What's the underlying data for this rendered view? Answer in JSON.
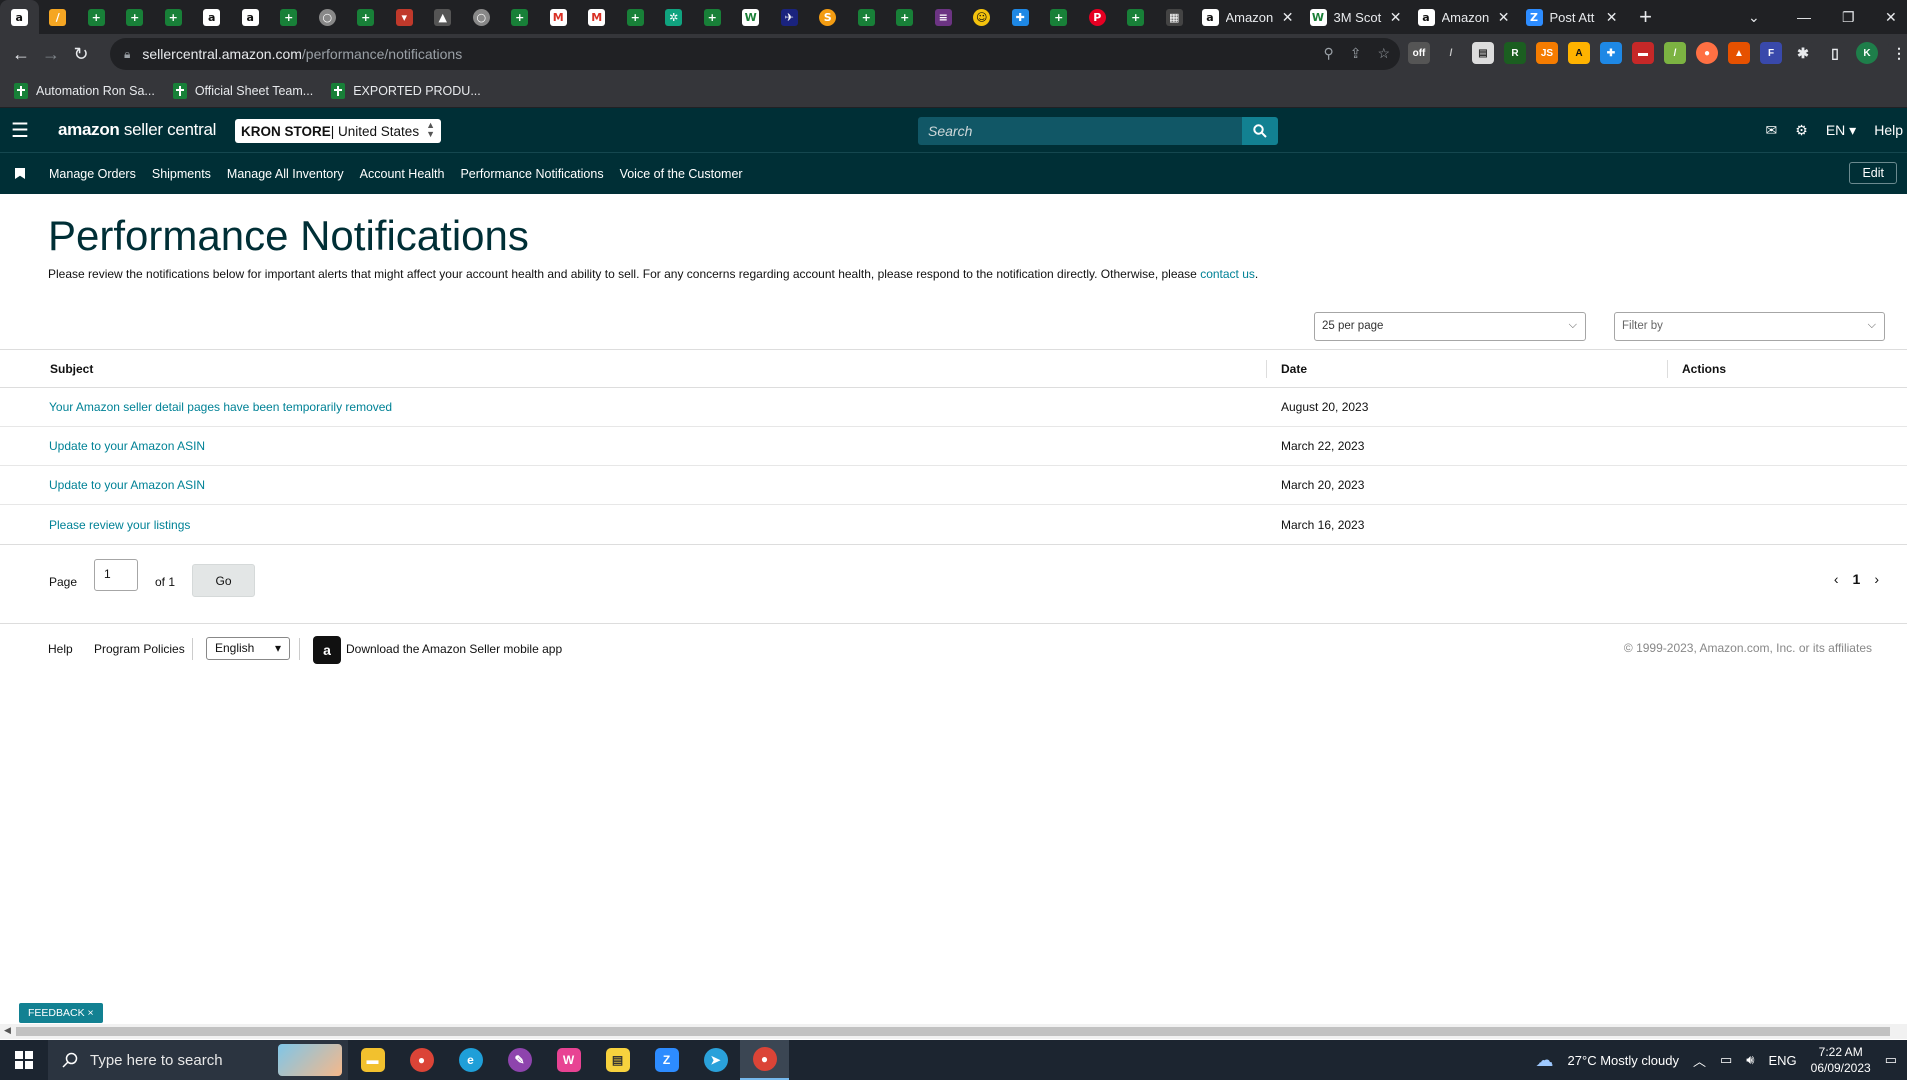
{
  "browser": {
    "tabs_full": [
      {
        "title": "Amazon",
        "icon": "amazon-icon"
      },
      {
        "title": "3M Scot",
        "icon": "w-icon"
      },
      {
        "title": "Amazon",
        "icon": "amazon-icon"
      },
      {
        "title": "Post Att",
        "icon": "z-icon"
      }
    ],
    "new_tab": "+",
    "url_host": "sellercentral.amazon.com",
    "url_path": "/performance/notifications",
    "bookmarks": [
      {
        "label": "Automation Ron Sa..."
      },
      {
        "label": "Official Sheet Team..."
      },
      {
        "label": "EXPORTED PRODU..."
      }
    ],
    "profile_initial": "K"
  },
  "header": {
    "logo_bold": "amazon",
    "logo_light": " seller central",
    "store_name": "KRON STORE",
    "store_market": " | United States",
    "search_placeholder": "Search",
    "language": "EN",
    "help": "Help"
  },
  "nav": {
    "links": [
      "Manage Orders",
      "Shipments",
      "Manage All Inventory",
      "Account Health",
      "Performance Notifications",
      "Voice of the Customer"
    ],
    "edit": "Edit"
  },
  "page": {
    "title": "Performance Notifications",
    "description": "Please review the notifications below for important alerts that might affect your account health and ability to sell. For any concerns regarding account health, please respond to the notification directly. Otherwise, please ",
    "contact_link": "contact us",
    "description_end": ".",
    "per_page": "25 per page",
    "filter_by": "Filter by"
  },
  "table": {
    "headers": {
      "subject": "Subject",
      "date": "Date",
      "actions": "Actions"
    },
    "rows": [
      {
        "subject": "Your Amazon seller detail pages have been temporarily removed",
        "date": "August 20, 2023"
      },
      {
        "subject": "Update to your Amazon ASIN",
        "date": "March 22, 2023"
      },
      {
        "subject": "Update to your Amazon ASIN",
        "date": "March 20, 2023"
      },
      {
        "subject": "Please review your listings",
        "date": "March 16, 2023"
      }
    ]
  },
  "pager": {
    "page_label": "Page",
    "page_value": "1",
    "of_label": "of 1",
    "go": "Go",
    "current": "1"
  },
  "footer": {
    "help": "Help",
    "policies": "Program Policies",
    "language": "English",
    "app_link": "Download the Amazon Seller mobile app",
    "copyright": "© 1999-2023, Amazon.com, Inc. or its affiliates"
  },
  "feedback": "FEEDBACK ×",
  "taskbar": {
    "search_placeholder": "Type here to search",
    "weather": "27°C  Mostly cloudy",
    "lang": "ENG",
    "time": "7:22 AM",
    "date": "06/09/2023"
  }
}
